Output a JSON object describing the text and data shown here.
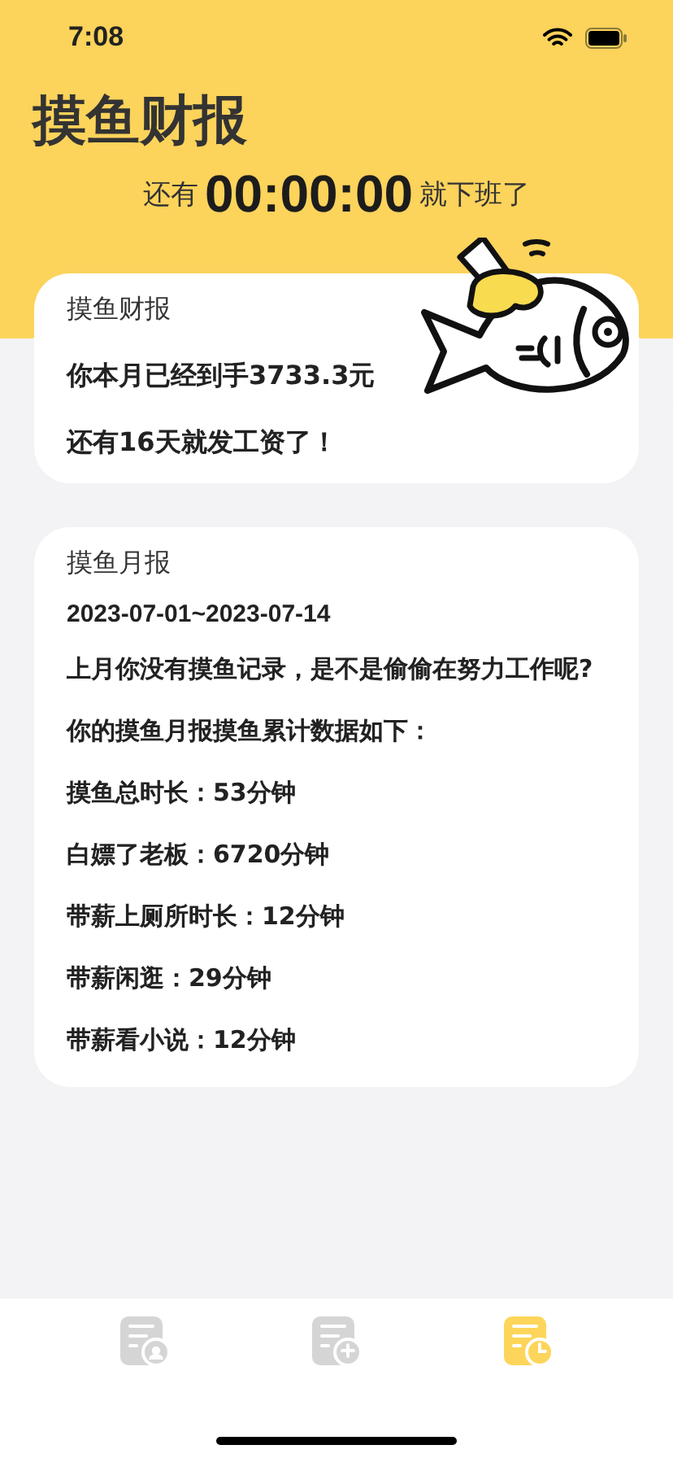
{
  "status_bar": {
    "time": "7:08"
  },
  "title": "摸鱼财报",
  "countdown": {
    "prefix": "还有",
    "time": "00:00:00",
    "suffix": "就下班了"
  },
  "income_card": {
    "title": "摸鱼财报",
    "lines": [
      "你本月已经到手3733.3元",
      "还有16天就发工资了！"
    ]
  },
  "monthly_card": {
    "title": "摸鱼月报",
    "date_range": "2023-07-01~2023-07-14",
    "lines": [
      "上月你没有摸鱼记录，是不是偷偷在努力工作呢?",
      "你的摸鱼月报摸鱼累计数据如下：",
      "摸鱼总时长：53分钟",
      "白嫖了老板：6720分钟",
      "带薪上厕所时长：12分钟",
      "带薪闲逛：29分钟",
      "带薪看小说：12分钟"
    ]
  },
  "tab_bar": {
    "items": [
      {
        "kind": "person",
        "selected": false
      },
      {
        "kind": "add",
        "selected": false
      },
      {
        "kind": "clock",
        "selected": true
      }
    ]
  }
}
